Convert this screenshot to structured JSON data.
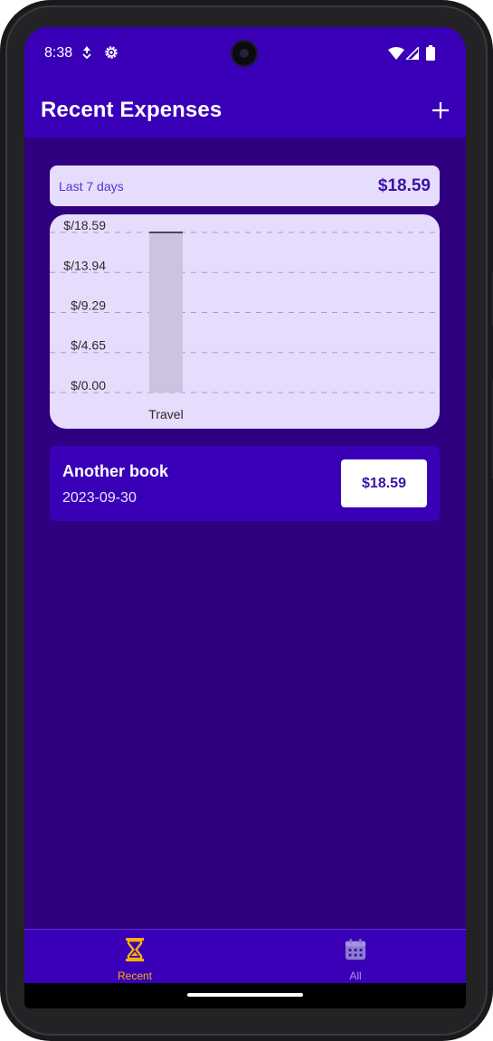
{
  "status_bar": {
    "time": "8:38",
    "left_icons": [
      "data-saver-icon",
      "settings-gear-icon"
    ],
    "right_icons": [
      "wifi-icon",
      "signal-icon",
      "battery-icon"
    ]
  },
  "app_bar": {
    "title": "Recent Expenses",
    "add_icon": "plus-icon"
  },
  "summary": {
    "label": "Last 7 days",
    "total": "$18.59"
  },
  "chart_data": {
    "type": "bar",
    "categories": [
      "Travel"
    ],
    "values": [
      18.59
    ],
    "y_ticks": [
      "$/18.59",
      "$/13.94",
      "$/9.29",
      "$/4.65",
      "$/0.00"
    ],
    "y_tick_values": [
      18.59,
      13.94,
      9.29,
      4.65,
      0
    ],
    "ylim": [
      0,
      18.59
    ],
    "grid": "dashed-horizontal",
    "bar_color": "#cbc3e0"
  },
  "expenses": [
    {
      "title": "Another book",
      "date": "2023-09-30",
      "amount": "$18.59"
    }
  ],
  "bottom_nav": [
    {
      "label": "Recent",
      "icon": "hourglass-icon",
      "active": true
    },
    {
      "label": "All",
      "icon": "calendar-icon",
      "active": false
    }
  ],
  "colors": {
    "primary": "#3900b8",
    "background": "#2f0080",
    "card": "#e6dcfc",
    "accent": "#f5b10a",
    "inactive": "#a993e6"
  }
}
